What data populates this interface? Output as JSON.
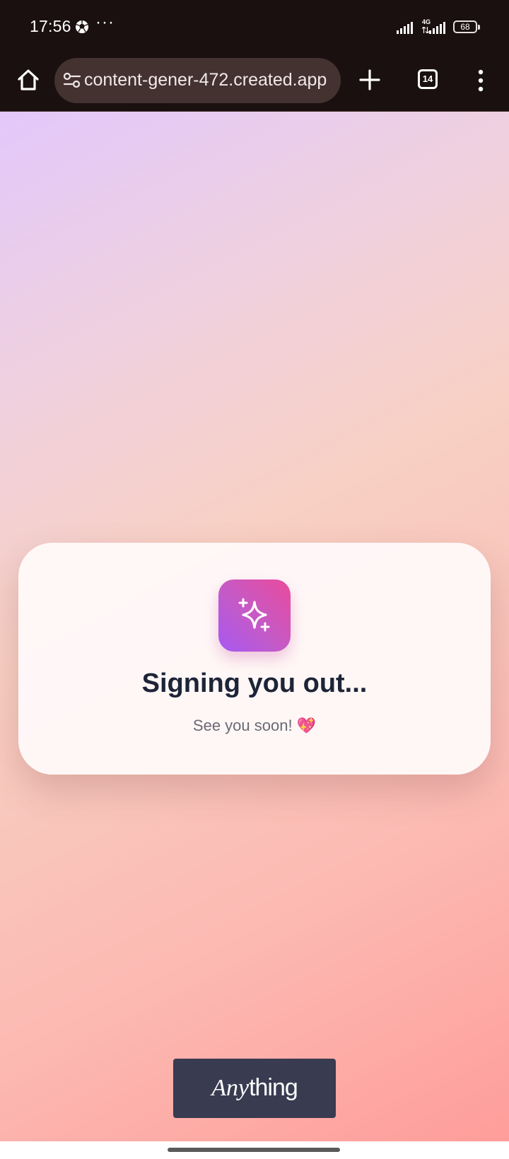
{
  "status_bar": {
    "time": "17:56",
    "dots": "···",
    "network": "4G",
    "battery": "68"
  },
  "browser": {
    "url": "content-gener-472.created.app",
    "tab_count": "14"
  },
  "card": {
    "title": "Signing you out...",
    "subtitle": "See you soon! 💖"
  },
  "brand": {
    "italic_part": "Any",
    "regular_part": "thing"
  },
  "colors": {
    "status_bg": "#1b1010",
    "url_pill": "#433230",
    "title": "#1d2437",
    "badge_bg": "#393b51",
    "icon_gradient_start": "#e94b9c",
    "icon_gradient_end": "#a658f2"
  },
  "icons": {
    "home": "home-icon",
    "site_settings": "tune-icon",
    "new_tab": "plus-icon",
    "tabs": "tab-switcher-icon",
    "menu": "more-vertical-icon",
    "logo": "sparkles-icon"
  }
}
